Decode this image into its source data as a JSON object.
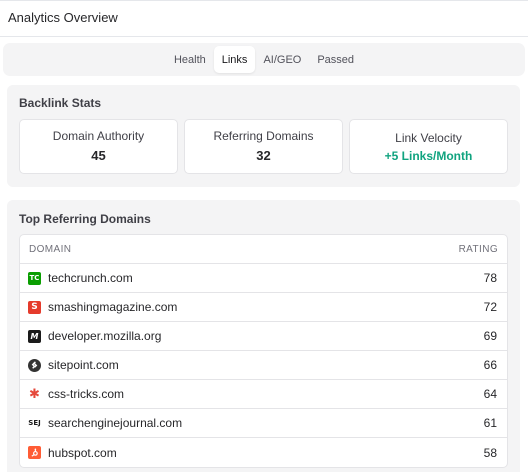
{
  "header": {
    "title": "Analytics Overview"
  },
  "tabs": [
    {
      "label": "Health",
      "active": false
    },
    {
      "label": "Links",
      "active": true
    },
    {
      "label": "AI/GEO",
      "active": false
    },
    {
      "label": "Passed",
      "active": false
    }
  ],
  "backlink_stats": {
    "title": "Backlink Stats",
    "cards": [
      {
        "label": "Domain Authority",
        "value": "45"
      },
      {
        "label": "Referring Domains",
        "value": "32"
      },
      {
        "label": "Link Velocity",
        "value": "+5 Links/Month",
        "color": "#10a37f"
      }
    ]
  },
  "top_domains": {
    "title": "Top Referring Domains",
    "columns": {
      "domain": "DOMAIN",
      "rating": "RATING"
    },
    "rows": [
      {
        "domain": "techcrunch.com",
        "rating": "78",
        "icon": "techcrunch-favicon",
        "icon_color": "#0a9e01"
      },
      {
        "domain": "smashingmagazine.com",
        "rating": "72",
        "icon": "smashingmagazine-favicon",
        "icon_color": "#e53b2c"
      },
      {
        "domain": "developer.mozilla.org",
        "rating": "69",
        "icon": "mdn-favicon",
        "icon_color": "#1b1b1b"
      },
      {
        "domain": "sitepoint.com",
        "rating": "66",
        "icon": "sitepoint-favicon",
        "icon_color": "#333333"
      },
      {
        "domain": "css-tricks.com",
        "rating": "64",
        "icon": "css-tricks-favicon",
        "icon_color": "#e5483b"
      },
      {
        "domain": "searchenginejournal.com",
        "rating": "61",
        "icon": "sej-favicon",
        "icon_color": "#1a1a1a"
      },
      {
        "domain": "hubspot.com",
        "rating": "58",
        "icon": "hubspot-favicon",
        "icon_color": "#ff5c35"
      }
    ]
  }
}
